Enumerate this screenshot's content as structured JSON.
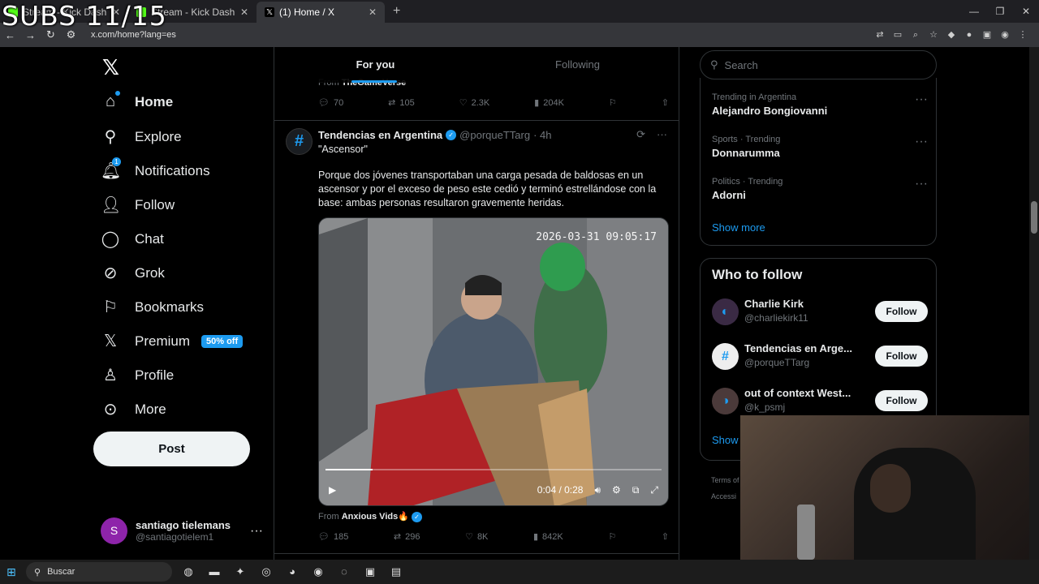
{
  "overlay": {
    "subs_text": "SUBS 11/15"
  },
  "browser": {
    "tabs": [
      {
        "label": "Stream - Kick Dashboard",
        "icon": "kick-icon"
      },
      {
        "label": "Stream - Kick Dashboard",
        "icon": "kick-icon"
      },
      {
        "label": "(1) Home / X",
        "icon": "x-icon"
      }
    ],
    "url": "x.com/home?lang=es"
  },
  "sidebar": {
    "logo": "𝕏",
    "items": [
      {
        "label": "Home",
        "icon": "home-icon"
      },
      {
        "label": "Explore",
        "icon": "search-icon"
      },
      {
        "label": "Notifications",
        "icon": "bell-icon",
        "badge": "1"
      },
      {
        "label": "Follow",
        "icon": "person-plus-icon"
      },
      {
        "label": "Chat",
        "icon": "chat-icon"
      },
      {
        "label": "Grok",
        "icon": "grok-icon"
      },
      {
        "label": "Bookmarks",
        "icon": "bookmark-icon"
      },
      {
        "label": "Premium",
        "icon": "x-icon",
        "badge": "50% off"
      },
      {
        "label": "Profile",
        "icon": "profile-icon"
      },
      {
        "label": "More",
        "icon": "more-circle-icon"
      }
    ],
    "post_label": "Post",
    "account": {
      "avatar_letter": "S",
      "name": "santiago tielemans",
      "handle": "@santiagotielem1"
    }
  },
  "feed": {
    "tabs": [
      {
        "label": "For you"
      },
      {
        "label": "Following"
      }
    ],
    "prev_tweet": {
      "from_prefix": "From",
      "from_name": "TheGameVerse",
      "stats": {
        "replies": "70",
        "reposts": "105",
        "likes": "2.3K",
        "views": "204K"
      }
    },
    "tweet": {
      "name": "Tendencias en Argentina",
      "handle": "@porqueTTarg",
      "time": "· 4h",
      "title": "\"Ascensor\"",
      "body": "Porque dos jóvenes transportaban una carga pesada de baldosas en un ascensor y por el exceso de peso este cedió y terminó estrellándose con la base: ambas personas resultaron gravemente heridas.",
      "video": {
        "timestamp": "2026-03-31 09:05:17",
        "time_display": "0:04 / 0:28",
        "progress": 0.14
      },
      "from_prefix": "From",
      "from_name": "Anxious Vids🔥",
      "stats": {
        "replies": "185",
        "reposts": "296",
        "likes": "8K",
        "views": "842K"
      }
    }
  },
  "right": {
    "search_placeholder": "Search",
    "trends": [
      {
        "meta": "Trending in Argentina",
        "topic": "Alejandro Bongiovanni"
      },
      {
        "meta": "Sports · Trending",
        "topic": "Donnarumma"
      },
      {
        "meta": "Politics · Trending",
        "topic": "Adorni"
      }
    ],
    "show_more": "Show more",
    "who_to_follow": {
      "title": "Who to follow",
      "items": [
        {
          "name": "Charlie Kirk",
          "handle": "@charliekirk11",
          "button": "Follow"
        },
        {
          "name": "Tendencias en Arge...",
          "handle": "@porqueTTarg",
          "button": "Follow"
        },
        {
          "name": "out of context West...",
          "handle": "@k_psmj",
          "button": "Follow"
        }
      ],
      "show_label": "Show"
    },
    "footer": {
      "line1": "Terms of",
      "line2": "Accessi"
    }
  },
  "taskbar": {
    "search_label": "Buscar"
  },
  "colors": {
    "accent": "#1d9bf0",
    "background": "#000000",
    "text": "#e7e9ea",
    "muted": "#71767b"
  }
}
